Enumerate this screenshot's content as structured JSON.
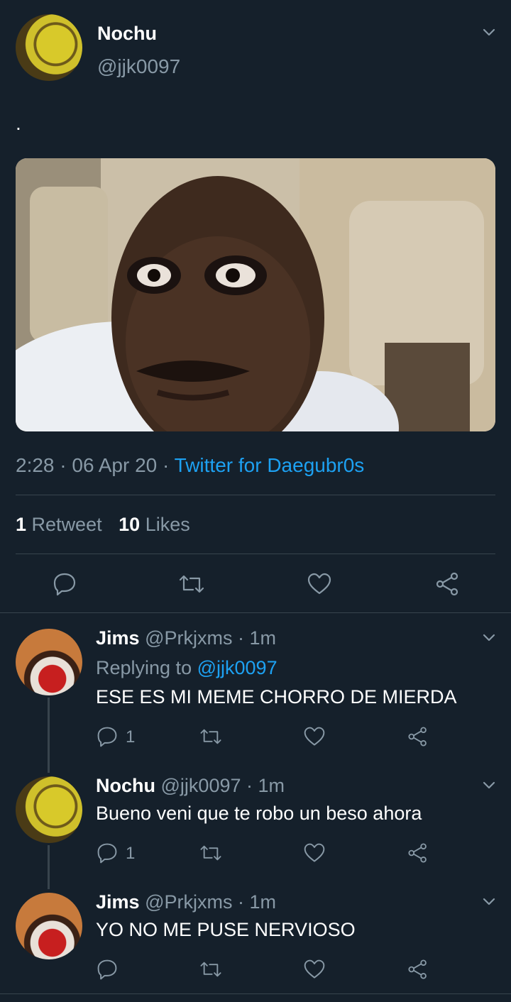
{
  "main_tweet": {
    "author_name": "Nochu",
    "handle": "@jjk0097",
    "text": ".",
    "meta_time_date": "2:28 · 06 Apr 20 ·",
    "meta_client": "Twitter for Daegubr0s",
    "retweet_count": "1",
    "retweet_label": "Retweet",
    "like_count": "10",
    "like_label": "Likes"
  },
  "replies": [
    {
      "name": "Jims",
      "handle_time": "@Prkjxms · 1m",
      "replying_prefix": "Replying to",
      "replying_handle": "@jjk0097",
      "text": "ESE ES MI MEME CHORRO DE MIERDA",
      "reply_count": "1"
    },
    {
      "name": "Nochu",
      "handle_time": "@jjk0097 · 1m",
      "text": "Bueno veni que te robo un beso ahora",
      "reply_count": "1"
    },
    {
      "name": "Jims",
      "handle_time": "@Prkjxms · 1m",
      "text": "YO NO ME PUSE NERVIOSO"
    }
  ],
  "icons": {
    "reply": "reply-icon",
    "retweet": "retweet-icon",
    "like": "heart-icon",
    "share": "share-icon",
    "more": "chevron-down-icon"
  },
  "colors": {
    "background": "#15202b",
    "muted": "#8899a6",
    "link": "#1da1f2",
    "divider": "#38444d"
  }
}
